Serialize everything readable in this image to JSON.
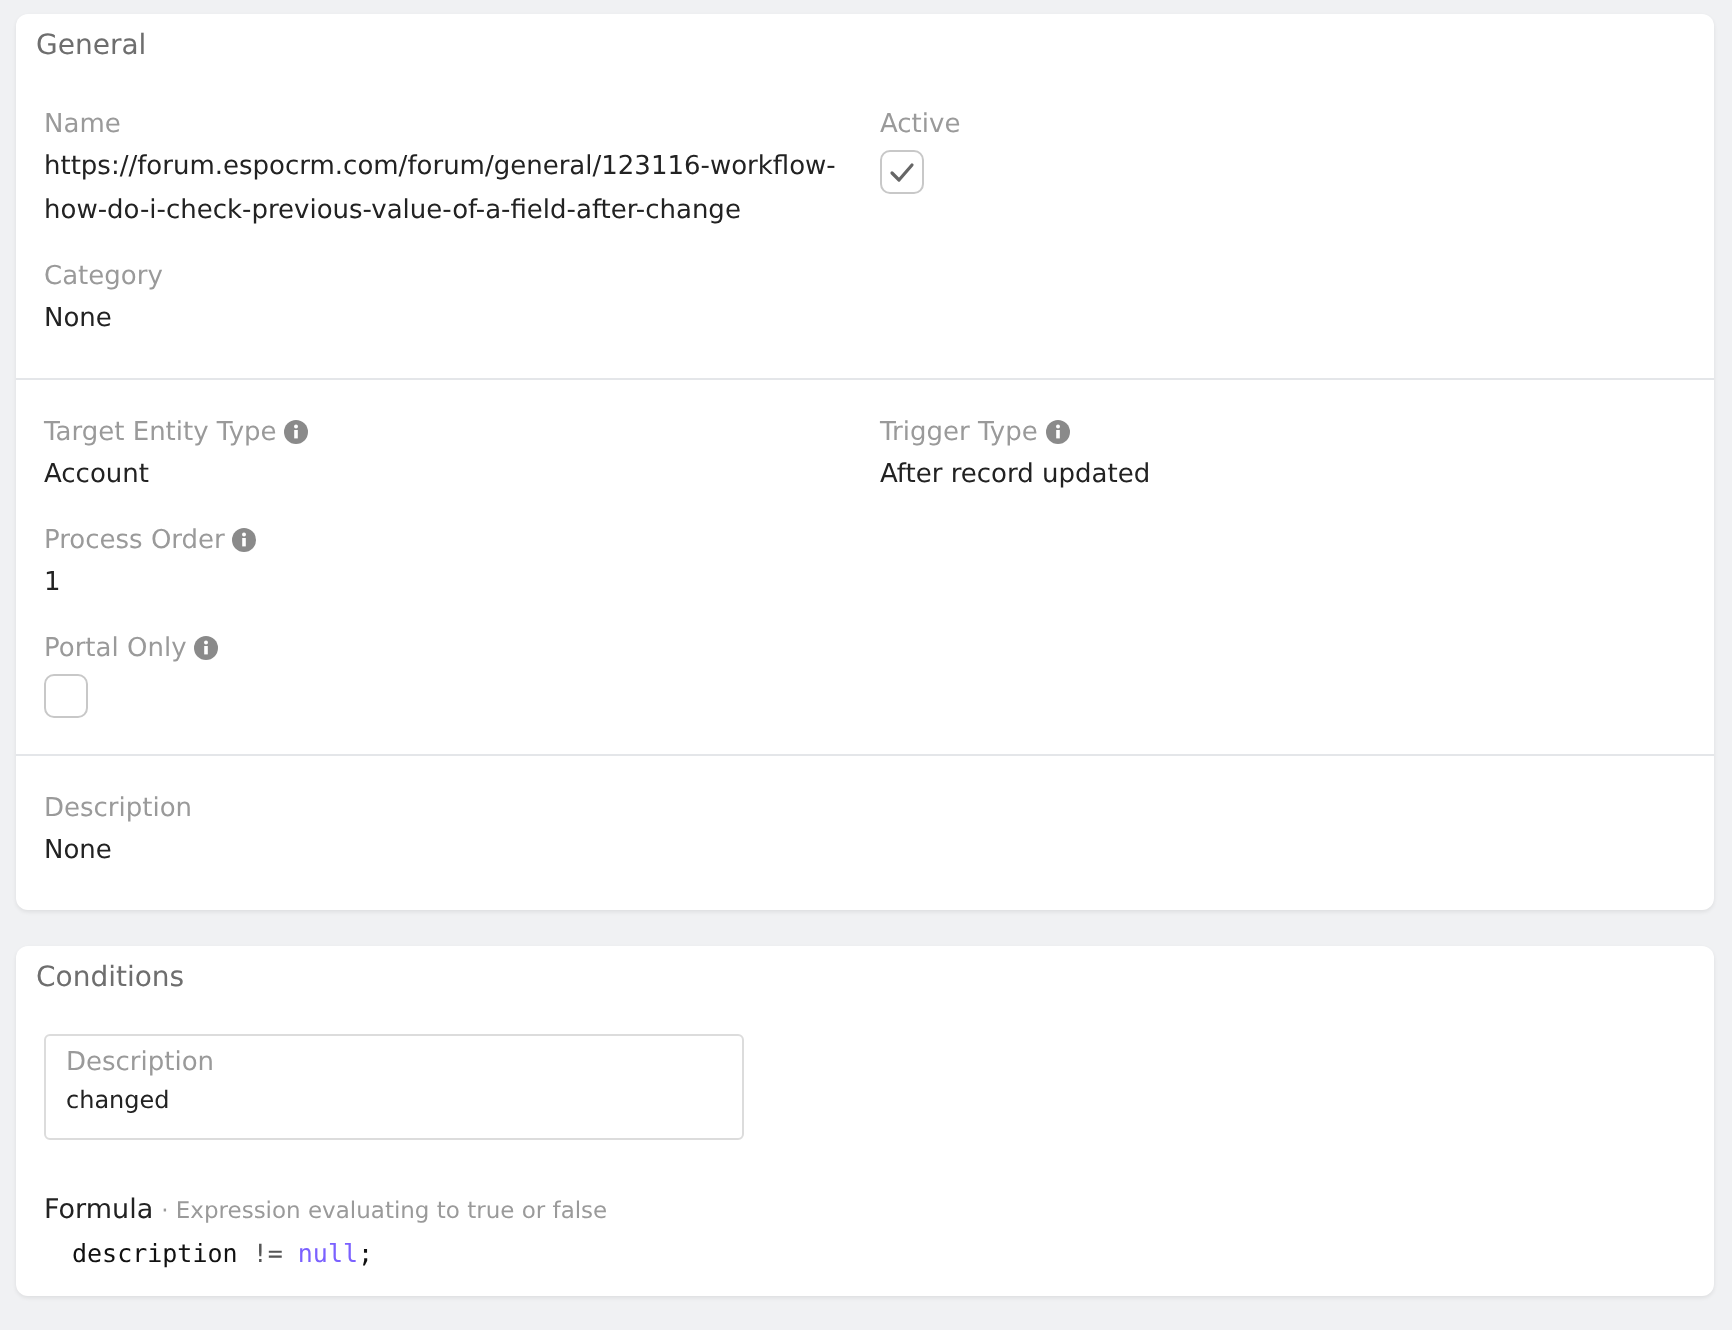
{
  "general": {
    "title": "General",
    "sections": [
      {
        "columns": [
          [
            {
              "label": "Name",
              "kind": "text",
              "value": "https://forum.espocrm.com/forum/general/123116-workflow-how-do-i-check-previous-value-of-a-field-after-change"
            },
            {
              "label": "Category",
              "kind": "text",
              "value": "None"
            }
          ],
          [
            {
              "label": "Active",
              "kind": "checkbox",
              "checked": true
            }
          ]
        ]
      },
      {
        "columns": [
          [
            {
              "label": "Target Entity Type",
              "kind": "text",
              "value": "Account",
              "info": true
            },
            {
              "label": "Process Order",
              "kind": "text",
              "value": "1",
              "info": true
            },
            {
              "label": "Portal Only",
              "kind": "checkbox",
              "checked": false,
              "info": true
            }
          ],
          [
            {
              "label": "Trigger Type",
              "kind": "text",
              "value": "After record updated",
              "info": true
            }
          ]
        ]
      },
      {
        "columns": [
          [
            {
              "label": "Description",
              "kind": "text",
              "value": "None"
            }
          ]
        ]
      }
    ]
  },
  "conditions": {
    "title": "Conditions",
    "description": {
      "label": "Description",
      "value": "changed"
    },
    "formula": {
      "label": "Formula",
      "hint": "· Expression evaluating to true or false",
      "code": [
        {
          "text": "description",
          "kind": "identifier"
        },
        {
          "text": "!=",
          "kind": "operator"
        },
        {
          "text": "null",
          "kind": "keyword"
        },
        {
          "text": ";",
          "kind": "punct"
        }
      ]
    }
  }
}
